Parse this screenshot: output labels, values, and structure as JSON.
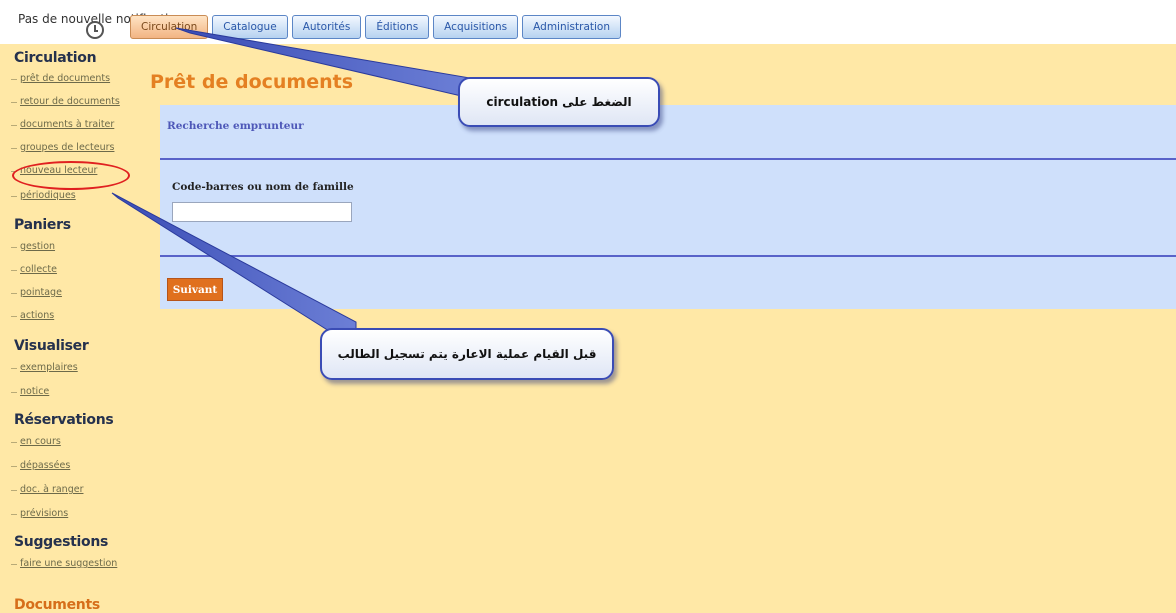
{
  "topbar": {
    "notification": "Pas de nouvelle notification",
    "tabs": [
      "Circulation",
      "Catalogue",
      "Autorités",
      "Éditions",
      "Acquisitions",
      "Administration"
    ],
    "active_tab": "Circulation"
  },
  "sidebar": {
    "circulation": {
      "title": "Circulation",
      "links": [
        "prêt de documents",
        "retour de documents",
        "documents à traiter",
        "groupes de lecteurs",
        "nouveau lecteur",
        "périodiques"
      ]
    },
    "paniers": {
      "title": "Paniers",
      "links": [
        "gestion",
        "collecte",
        "pointage",
        "actions"
      ]
    },
    "visualiser": {
      "title": "Visualiser",
      "links": [
        "exemplaires",
        "notice"
      ]
    },
    "reservations": {
      "title": "Réservations",
      "links": [
        "en cours",
        "dépassées",
        "doc. à ranger",
        "prévisions"
      ]
    },
    "suggestions": {
      "title": "Suggestions",
      "links": [
        "faire une suggestion"
      ]
    },
    "documents": {
      "title": "Documents"
    }
  },
  "main": {
    "title": "Prêt de documents",
    "panel_title": "Recherche emprunteur",
    "field_label": "Code-barres ou nom de famille",
    "field_value": "",
    "next_button": "Suivant"
  },
  "callouts": {
    "top": "الضغط على circulation",
    "bottom": "قبل القيام عملية الاعارة يتم تسجيل الطالب"
  },
  "colors": {
    "background": "#ffe8a6",
    "panel": "#cfe0fb",
    "accent_orange": "#e48022",
    "divider": "#5963c9"
  }
}
